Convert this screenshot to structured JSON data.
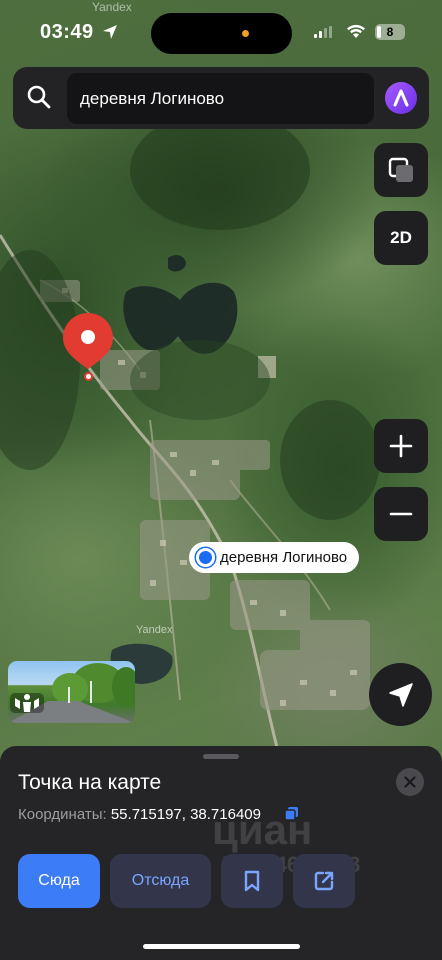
{
  "status_bar": {
    "time": "03:49",
    "battery": "8",
    "icons": [
      "location-arrow-icon",
      "signal-icon",
      "wifi-icon",
      "battery-icon"
    ]
  },
  "map": {
    "watermarks": [
      "Yandex",
      "Yandex"
    ],
    "place_label": "деревня Логиново",
    "controls": {
      "layers_icon": "layers-icon",
      "mode": "2D",
      "zoom_in_icon": "plus-icon",
      "zoom_out_icon": "minus-icon",
      "location_icon": "navigation-arrow-icon"
    }
  },
  "search": {
    "value": "деревня Логиново",
    "icon": "search-icon",
    "assistant_icon": "alice-icon"
  },
  "sheet": {
    "title": "Точка на карте",
    "coords_label": "Координаты:",
    "coords_value": "55.715197, 38.716409",
    "buttons": {
      "here": "Сюда",
      "from": "Отсюда",
      "bookmark_icon": "bookmark-icon",
      "share_icon": "share-icon"
    },
    "close_icon": "close-icon",
    "watermark": {
      "logo": "циан",
      "id": "ID 294640318"
    }
  },
  "colors": {
    "accent": "#3d7cf7",
    "pin": "#e23b32",
    "sheet_bg": "#252528",
    "user_dot": "#1b6cf2"
  }
}
